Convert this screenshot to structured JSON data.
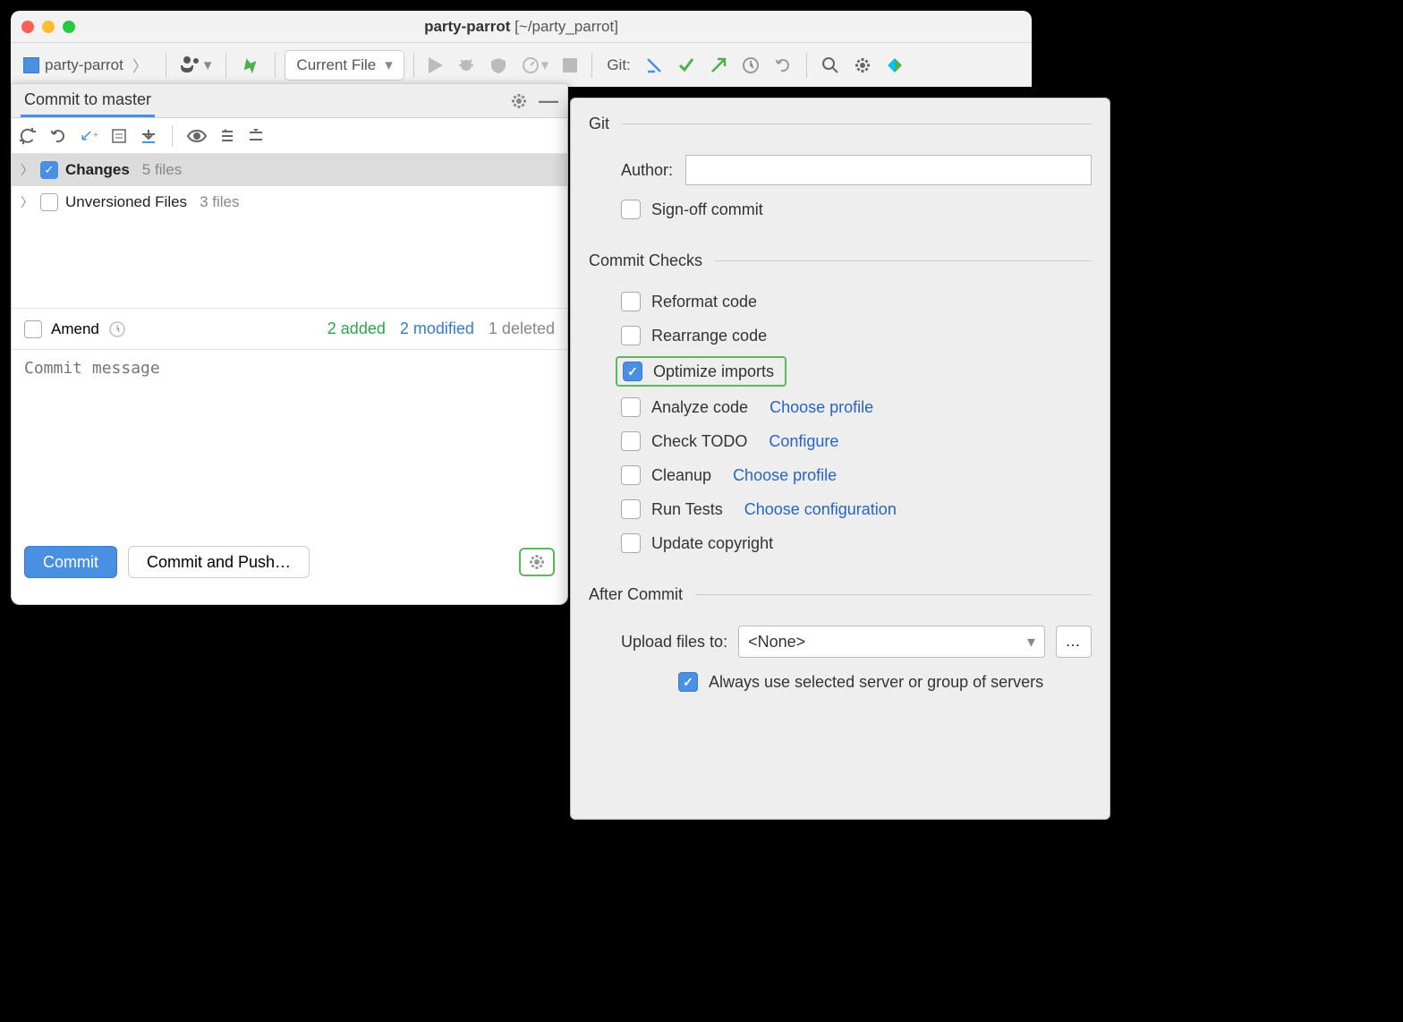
{
  "window": {
    "title_project": "party-parrot",
    "title_path": "[~/party_parrot]"
  },
  "toolbar": {
    "project_name": "party-parrot",
    "run_config": "Current File",
    "git_label": "Git:"
  },
  "commit_panel": {
    "tab": "Commit to master",
    "tree": {
      "changes_label": "Changes",
      "changes_count": "5 files",
      "unversioned_label": "Unversioned Files",
      "unversioned_count": "3 files"
    },
    "amend_label": "Amend",
    "stats": {
      "added": "2 added",
      "modified": "2 modified",
      "deleted": "1 deleted"
    },
    "msg_placeholder": "Commit message",
    "commit_btn": "Commit",
    "commit_push_btn": "Commit and Push…"
  },
  "options": {
    "git_section": "Git",
    "author_label": "Author:",
    "signoff_label": "Sign-off commit",
    "checks_section": "Commit Checks",
    "reformat": "Reformat code",
    "rearrange": "Rearrange code",
    "optimize": "Optimize imports",
    "analyze": "Analyze code",
    "analyze_link": "Choose profile",
    "todo": "Check TODO",
    "todo_link": "Configure",
    "cleanup": "Cleanup",
    "cleanup_link": "Choose profile",
    "runtests": "Run Tests",
    "runtests_link": "Choose configuration",
    "copyright": "Update copyright",
    "after_section": "After Commit",
    "upload_label": "Upload files to:",
    "upload_value": "<None>",
    "more_btn": "…",
    "always_label": "Always use selected server or group of servers"
  }
}
